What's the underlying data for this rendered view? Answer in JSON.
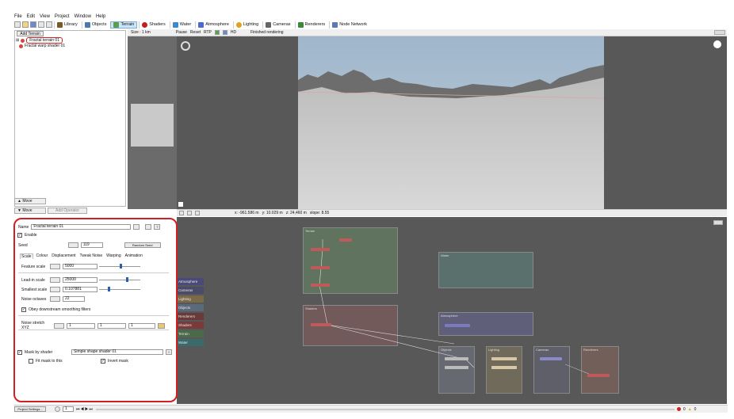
{
  "menu": [
    "File",
    "Edit",
    "View",
    "Project",
    "Window",
    "Help"
  ],
  "toolbar": {
    "buttons": [
      {
        "label": "Library",
        "icon": "library-icon",
        "color": "#7a5a2a"
      },
      {
        "label": "Objects",
        "icon": "objects-icon",
        "color": "#4a7ab0"
      },
      {
        "label": "Terrain",
        "icon": "terrain-icon",
        "color": "#5aa04a",
        "active": true
      },
      {
        "label": "Shaders",
        "icon": "shaders-icon",
        "color": "#c02020"
      },
      {
        "label": "Water",
        "icon": "water-icon",
        "color": "#3a8ad0"
      },
      {
        "label": "Atmosphere",
        "icon": "atmosphere-icon",
        "color": "#4a6ad0"
      },
      {
        "label": "Lighting",
        "icon": "lighting-icon",
        "color": "#e0a020"
      },
      {
        "label": "Cameras",
        "icon": "cameras-icon",
        "color": "#666666"
      },
      {
        "label": "Renderers",
        "icon": "renderers-icon",
        "color": "#3a8a3a"
      },
      {
        "label": "Node Network",
        "icon": "node-network-icon",
        "color": "#5a7ab0"
      }
    ]
  },
  "left": {
    "add_button": "Add Terrain",
    "tree": [
      {
        "label": "Fractal terrain 01",
        "color": "#d04a3a"
      },
      {
        "label": "Fractal warp shader 01",
        "color": "#d04a3a"
      }
    ],
    "move_up": "Move",
    "move_down": "Move",
    "add_operator": "Add Operator"
  },
  "view_toolbar": {
    "size": "Size : 1 km",
    "pause": "Pause",
    "reset": "Reset",
    "rtp": "RTP",
    "hd": "HD",
    "status": "Finished rendering"
  },
  "status2": {
    "x": "x: -961.586 m",
    "y": "y: 10.029 m",
    "z": "z: 24,460 m",
    "slope": "slope: 8.55"
  },
  "params": {
    "name_label": "Name",
    "name_value": "Fractal terrain 01",
    "enable_label": "Enable",
    "seed_label": "Seed",
    "seed_value": "119",
    "random_seed": "Random Seed",
    "tabs": [
      "Scale",
      "Colour",
      "Displacement",
      "Tweak Noise",
      "Warping",
      "Animation"
    ],
    "feature_scale_label": "Feature scale",
    "feature_scale_value": "5000",
    "lead_in_scale_label": "Lead-in scale",
    "lead_in_scale_value": "25000",
    "smallest_scale_label": "Smallest scale",
    "smallest_scale_value": "0.107881",
    "noise_octaves_label": "Noise octaves",
    "noise_octaves_value": "22",
    "obey_label": "Obey downstream smoothing filters",
    "noise_stretch_label": "Noise stretch XYZ",
    "stretch_x": "1",
    "stretch_y": "1",
    "stretch_z": "1",
    "mask_label": "Mask by shader",
    "mask_value": "Simple shape shader 01",
    "fit_mask_label": "Fit mask to this",
    "invert_mask_label": "Invert mask"
  },
  "layers": [
    {
      "label": "Atmosphere",
      "color": "#4a4a7a"
    },
    {
      "label": "Cameras",
      "color": "#4a4a6a"
    },
    {
      "label": "Lighting",
      "color": "#7a6a4a"
    },
    {
      "label": "Objects",
      "color": "#5a6a7a"
    },
    {
      "label": "Renderers",
      "color": "#6a3a3a"
    },
    {
      "label": "Shaders",
      "color": "#7a3a3a"
    },
    {
      "label": "Terrain",
      "color": "#4a6a4a"
    },
    {
      "label": "Water",
      "color": "#3a6a6a"
    }
  ],
  "graph_groups": {
    "terrain": "Terrain",
    "water": "Water",
    "shaders": "Shaders",
    "atmosphere": "Atmosphere",
    "objects": "Objects",
    "lighting": "Lighting",
    "cameras": "Cameras",
    "renderers": "Renderers"
  },
  "bottom": {
    "project_settings": "Project Settings...",
    "frame": "1",
    "errors": "0",
    "warnings": "0"
  }
}
